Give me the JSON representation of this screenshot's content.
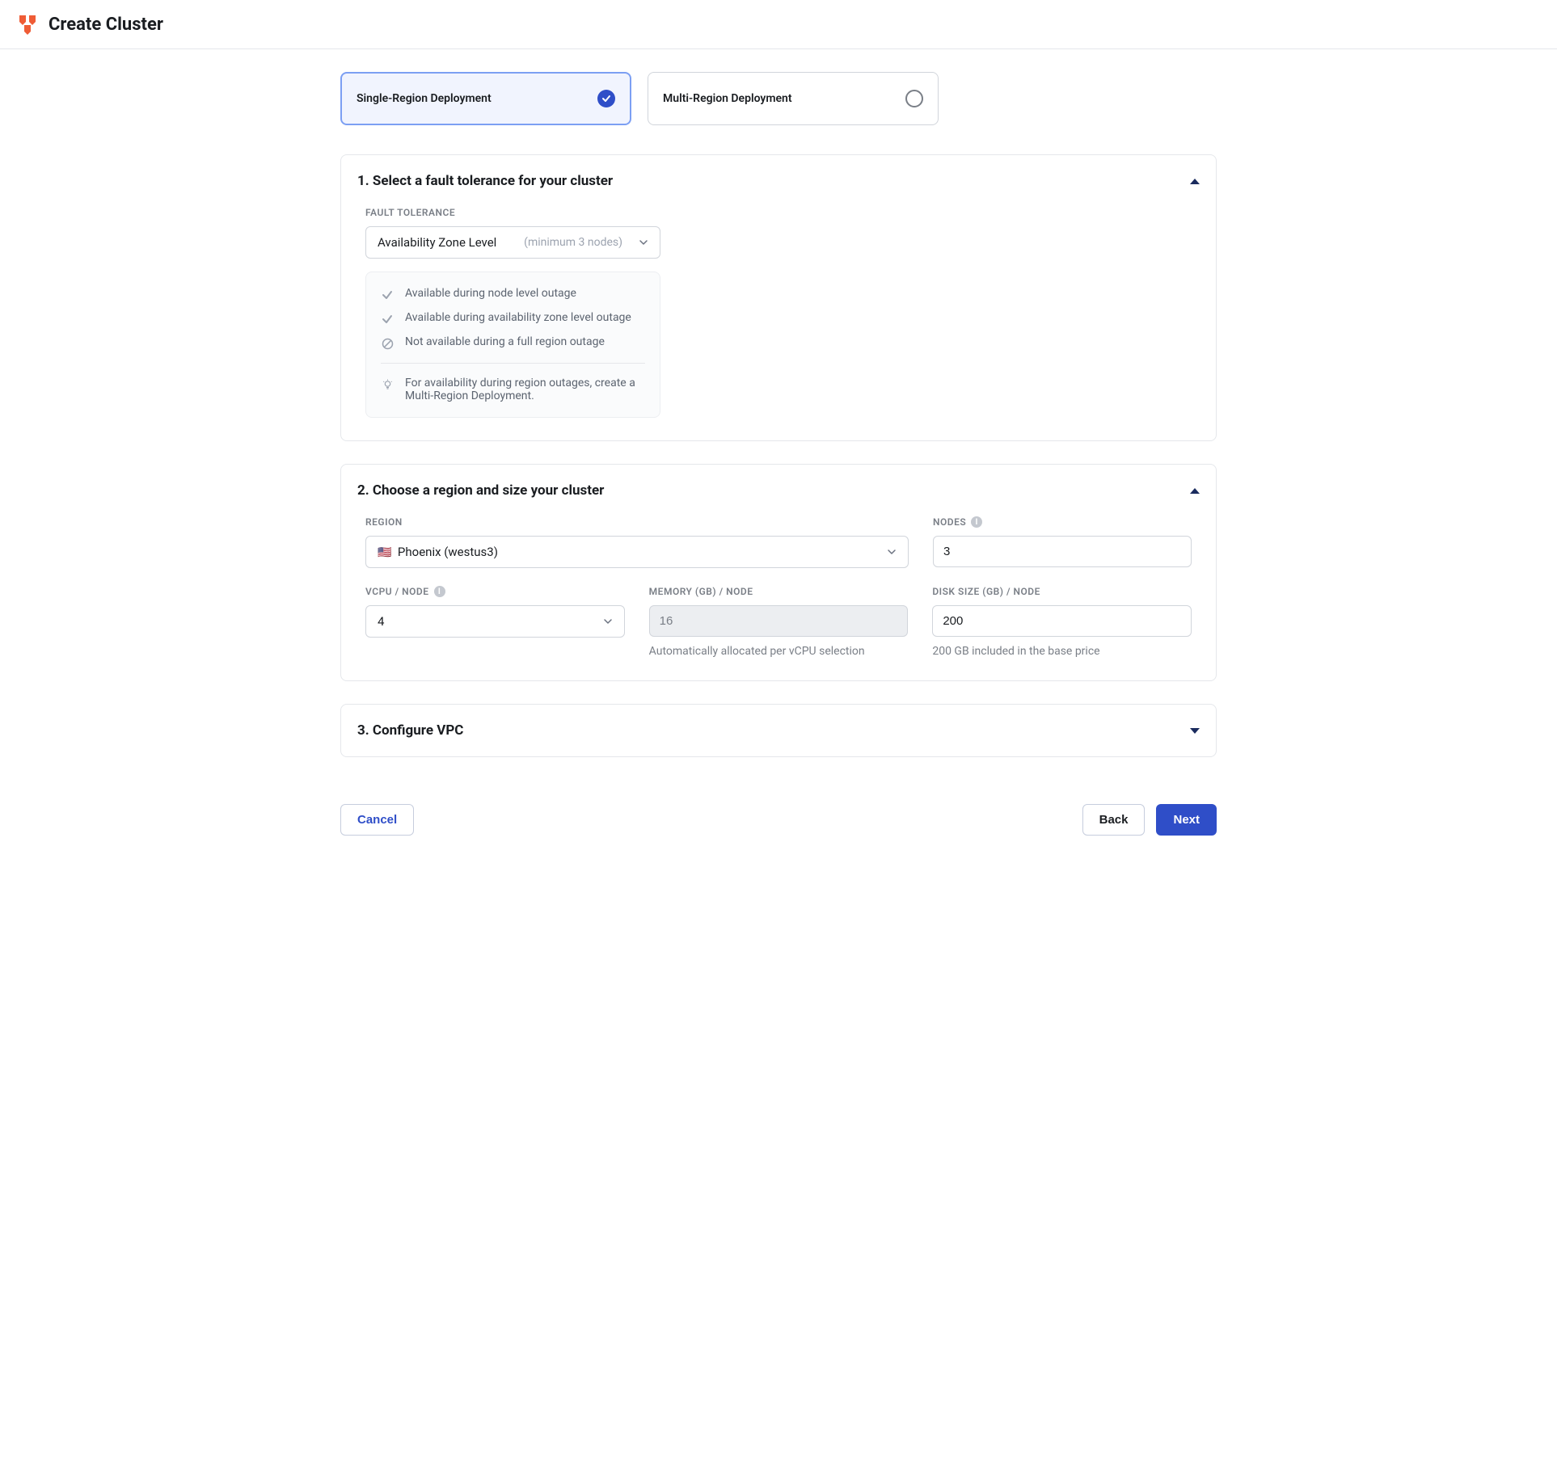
{
  "header": {
    "title": "Create Cluster"
  },
  "deployment": {
    "single": "Single-Region Deployment",
    "multi": "Multi-Region Deployment"
  },
  "panel1": {
    "title": "1. Select a fault tolerance for your cluster",
    "ft_label": "FAULT TOLERANCE",
    "ft_value": "Availability Zone Level",
    "ft_hint": "(minimum 3 nodes)",
    "bullets": {
      "b1": "Available during node level outage",
      "b2": "Available during availability zone level outage",
      "b3": "Not available during a full region outage"
    },
    "tip": "For availability during region outages, create a Multi-Region Deployment."
  },
  "panel2": {
    "title": "2. Choose a region and size your cluster",
    "region_label": "REGION",
    "region_value": "Phoenix (westus3)",
    "region_flag": "🇺🇸",
    "nodes_label": "NODES",
    "nodes_value": "3",
    "vcpu_label": "vCPU / NODE",
    "vcpu_value": "4",
    "mem_label": "MEMORY (GB) / NODE",
    "mem_value": "16",
    "mem_helper": "Automatically allocated per vCPU selection",
    "disk_label": "DISK SIZE (GB) / NODE",
    "disk_value": "200",
    "disk_helper": "200 GB included in the base price"
  },
  "panel3": {
    "title": "3. Configure VPC"
  },
  "footer": {
    "cancel": "Cancel",
    "back": "Back",
    "next": "Next"
  }
}
